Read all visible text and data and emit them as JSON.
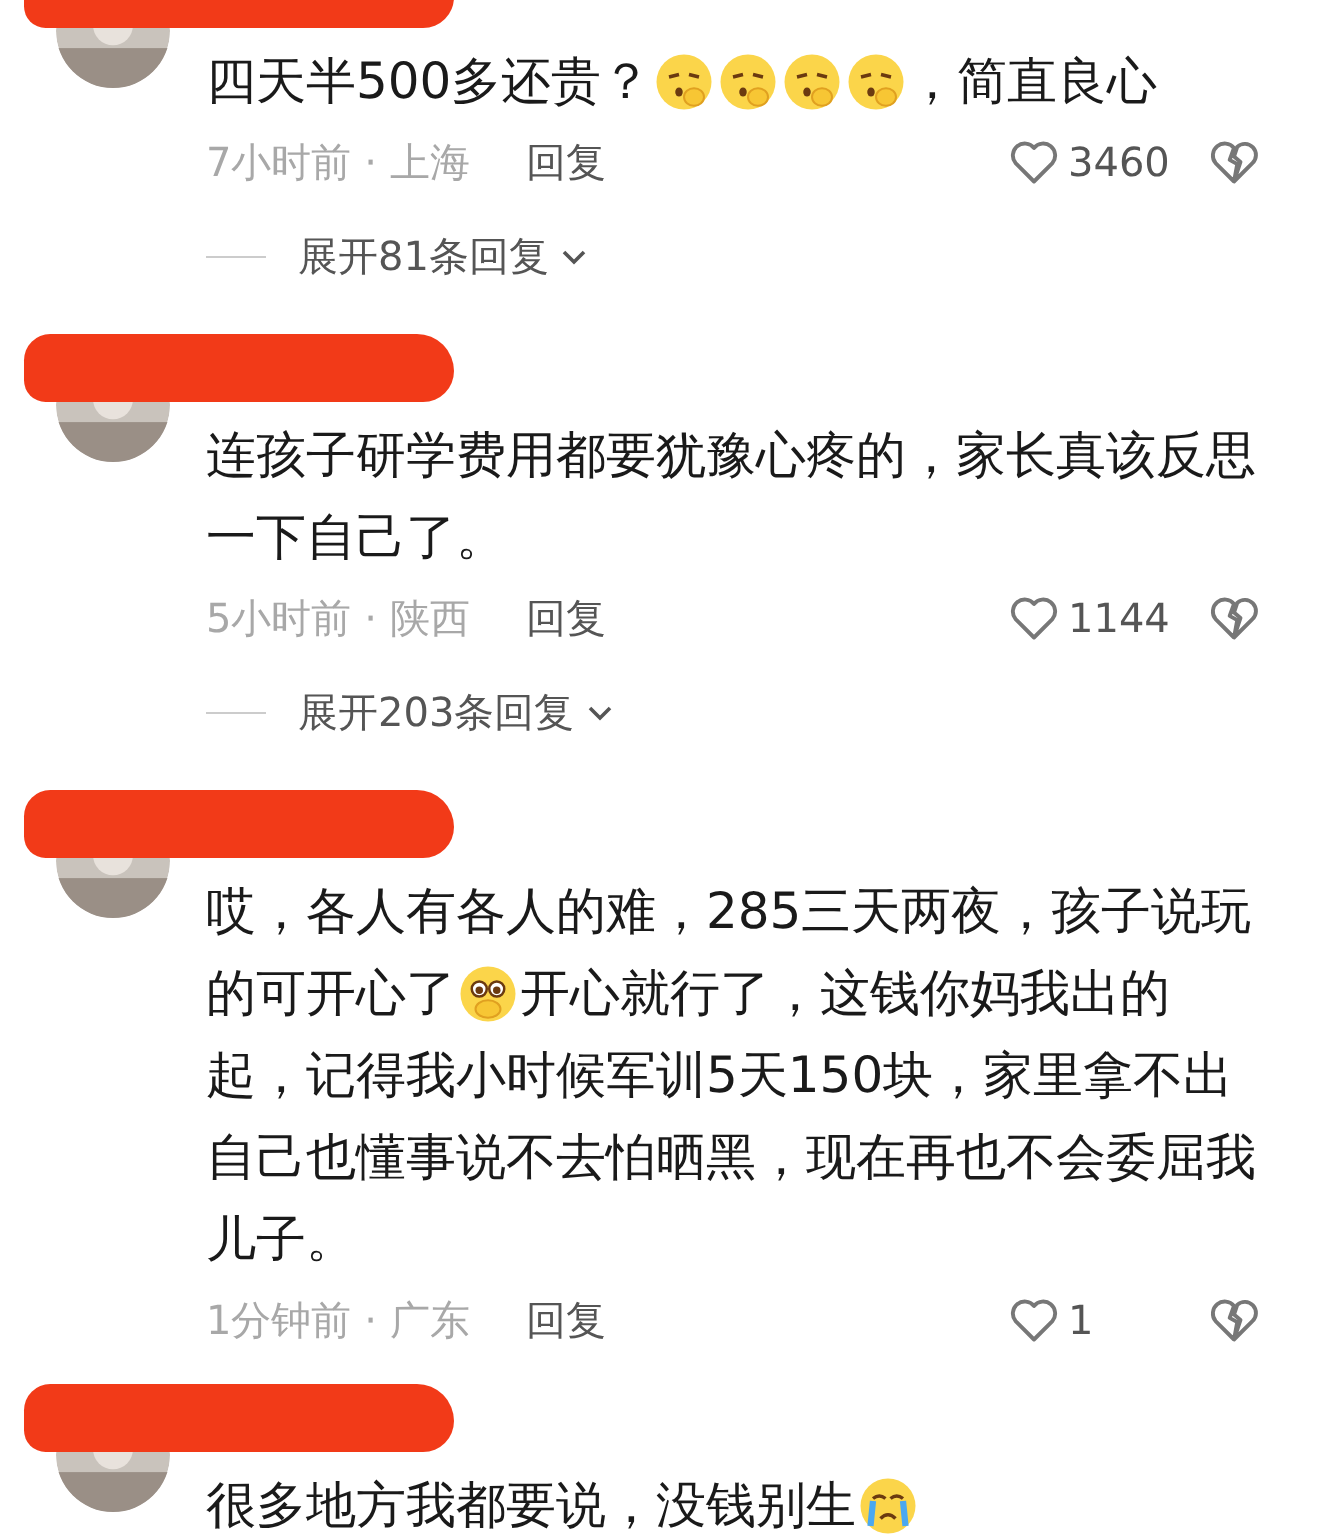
{
  "comments": [
    {
      "username_redacted": true,
      "lines": [
        [
          {
            "kind": "text",
            "text": "四天半500多还贵？"
          },
          {
            "kind": "sleepy-emoji"
          },
          {
            "kind": "sleepy-emoji"
          },
          {
            "kind": "sleepy-emoji"
          },
          {
            "kind": "sleepy-emoji"
          },
          {
            "kind": "text",
            "text": "，简直良心"
          }
        ]
      ],
      "time_place": "7小时前 · 上海",
      "reply": "回复",
      "likes": "3460",
      "expand": "展开81条回复"
    },
    {
      "username_redacted": true,
      "lines": [
        [
          {
            "kind": "text",
            "text": "连孩子研学费用都要犹豫心疼的，家长真该反思"
          }
        ],
        [
          {
            "kind": "text",
            "text": "一下自己了。"
          }
        ]
      ],
      "time_place": "5小时前 · 陕西",
      "reply": "回复",
      "likes": "1144",
      "expand": "展开203条回复"
    },
    {
      "username_redacted": true,
      "lines": [
        [
          {
            "kind": "text",
            "text": "哎，各人有各人的难，285三天两夜，孩子说玩"
          }
        ],
        [
          {
            "kind": "text",
            "text": "的可开心了"
          },
          {
            "kind": "pleading-emoji"
          },
          {
            "kind": "text",
            "text": "开心就行了，这钱你妈我出的"
          }
        ],
        [
          {
            "kind": "text",
            "text": "起，记得我小时候军训5天150块，家里拿不出"
          }
        ],
        [
          {
            "kind": "text",
            "text": "自己也懂事说不去怕晒黑，现在再也不会委屈我"
          }
        ],
        [
          {
            "kind": "text",
            "text": "儿子。"
          }
        ]
      ],
      "time_place": "1分钟前 · 广东",
      "reply": "回复",
      "likes": "1"
    },
    {
      "username_redacted": true,
      "lines": [
        [
          {
            "kind": "text",
            "text": "很多地方我都要说，没钱别生"
          },
          {
            "kind": "crying-emoji"
          }
        ]
      ]
    }
  ]
}
